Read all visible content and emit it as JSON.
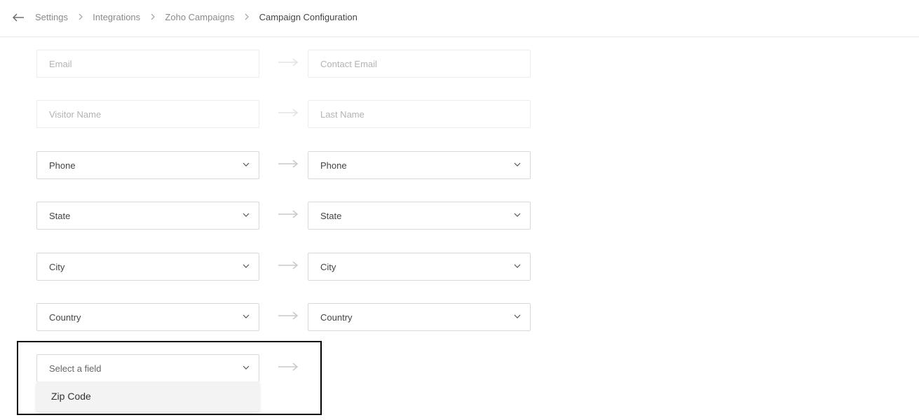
{
  "breadcrumb": {
    "items": [
      "Settings",
      "Integrations",
      "Zoho Campaigns"
    ],
    "current": "Campaign Configuration"
  },
  "icons": {
    "back": "back-arrow-icon",
    "separator": "chevron-right-icon",
    "dropdown": "chevron-down-icon",
    "mapping": "right-arrow-icon"
  },
  "mappings": [
    {
      "source": "Email",
      "target": "Contact Email",
      "type": "readonly"
    },
    {
      "source": "Visitor Name",
      "target": "Last Name",
      "type": "readonly"
    },
    {
      "source": "Phone",
      "target": "Phone",
      "type": "select"
    },
    {
      "source": "State",
      "target": "State",
      "type": "select"
    },
    {
      "source": "City",
      "target": "City",
      "type": "select"
    },
    {
      "source": "Country",
      "target": "Country",
      "type": "select"
    }
  ],
  "new_mapping": {
    "placeholder": "Select a field",
    "options": [
      "Zip Code"
    ]
  },
  "colors": {
    "border": "#d8d8d8",
    "disabled_border": "#ececec",
    "disabled_text": "#b3b3b3",
    "highlight": "#000000"
  }
}
